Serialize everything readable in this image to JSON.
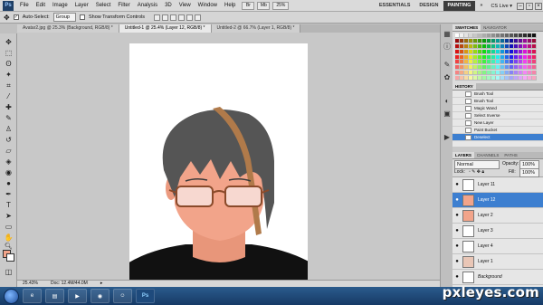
{
  "app": {
    "logo": "Ps"
  },
  "menu": [
    "File",
    "Edit",
    "Image",
    "Layer",
    "Select",
    "Filter",
    "Analysis",
    "3D",
    "View",
    "Window",
    "Help"
  ],
  "menu_ctrls": [
    "Br",
    "Mb",
    "25%"
  ],
  "workspaces": [
    "ESSENTIALS",
    "DESIGN",
    "PAINTING"
  ],
  "workspace_extra": "»",
  "cslive": "CS Live ▾",
  "options": {
    "auto_select": "Auto-Select:",
    "auto_select_value": "Group",
    "show_transform": "Show Transform Controls"
  },
  "tabs": [
    "Avatar2.jpg @ 25.3% (Background, RGB/8) *",
    "Untitled-1 @ 25.4% (Layer 12, RGB/8) *",
    "Untitled-2 @ 66.7% (Layer 1, RGB/8) *"
  ],
  "status": {
    "zoom": "25.43%",
    "doc": "Doc: 12.4M/44.0M"
  },
  "panels": {
    "swatch_tabs": [
      "SWATCHES",
      "NAVIGATOR"
    ],
    "history_tab": "HISTORY",
    "history_items": [
      "Brush Tool",
      "Brush Tool",
      "Magic Wand",
      "Select Inverse",
      "New Layer",
      "Paint Bucket",
      "Deselect"
    ],
    "layer_tabs": [
      "LAYERS",
      "CHANNELS",
      "PATHS"
    ],
    "blend_mode": "Normal",
    "opacity_label": "Opacity:",
    "opacity": "100%",
    "lock_label": "Lock:",
    "fill_label": "Fill:",
    "fill": "100%",
    "layers": [
      "Layer 11",
      "Layer 12",
      "Layer 2",
      "Layer 3",
      "Layer 4",
      "Layer 1",
      "Background"
    ]
  },
  "colors": {
    "skin": "#f2a48a",
    "hair": "#555555",
    "highlight": "#b07a4a",
    "shirt": "#111111",
    "selection": "#3d7fd0"
  },
  "watermark": "pxleyes.com"
}
